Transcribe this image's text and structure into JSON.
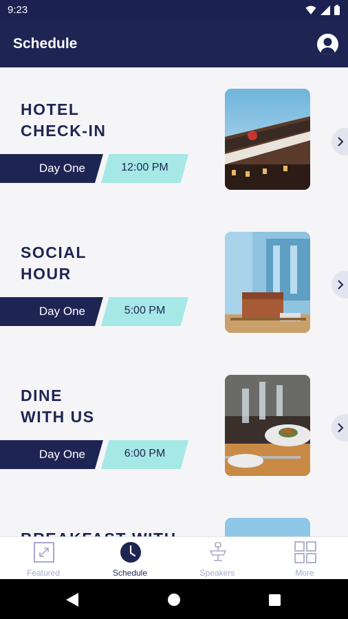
{
  "status": {
    "time": "9:23"
  },
  "header": {
    "title": "Schedule"
  },
  "events": [
    {
      "title": "HOTEL\nCHECK-IN",
      "day": "Day One",
      "time": "12:00 PM",
      "image": "hotel-building-photo"
    },
    {
      "title": "SOCIAL\nHOUR",
      "day": "Day One",
      "time": "5:00 PM",
      "image": "lounge-photo"
    },
    {
      "title": "DINE\nWITH US",
      "day": "Day One",
      "time": "6:00 PM",
      "image": "dinner-table-photo"
    },
    {
      "title": "BREAKFAST WITH",
      "image": "breakfast-photo"
    }
  ],
  "tabs": [
    {
      "label": "Featured",
      "icon": "featured-icon",
      "active": false
    },
    {
      "label": "Schedule",
      "icon": "clock-icon",
      "active": true
    },
    {
      "label": "Speakers",
      "icon": "speakers-icon",
      "active": false
    },
    {
      "label": "More",
      "icon": "grid-icon",
      "active": false
    }
  ],
  "colors": {
    "primary": "#1e2553",
    "accent": "#a5e8e6",
    "background": "#f5f5f7"
  }
}
